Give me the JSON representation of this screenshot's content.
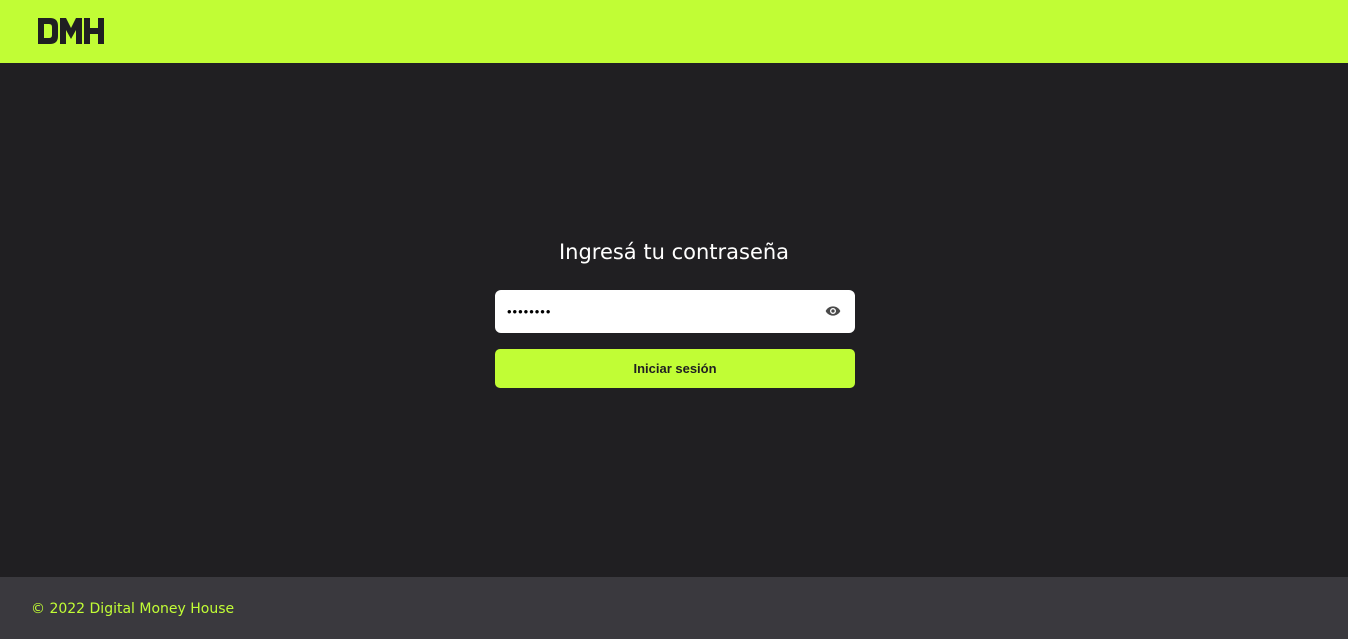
{
  "brand": {
    "logo_text": "DMH",
    "accent_color": "#c1fd35",
    "background_color": "#201f22",
    "footer_color": "#3a393e"
  },
  "login": {
    "title": "Ingresá tu contraseña",
    "password_value": "••••••••",
    "toggle_icon": "eye-icon",
    "submit_label": "Iniciar sesión"
  },
  "footer": {
    "copyright": "© 2022 Digital Money House"
  }
}
